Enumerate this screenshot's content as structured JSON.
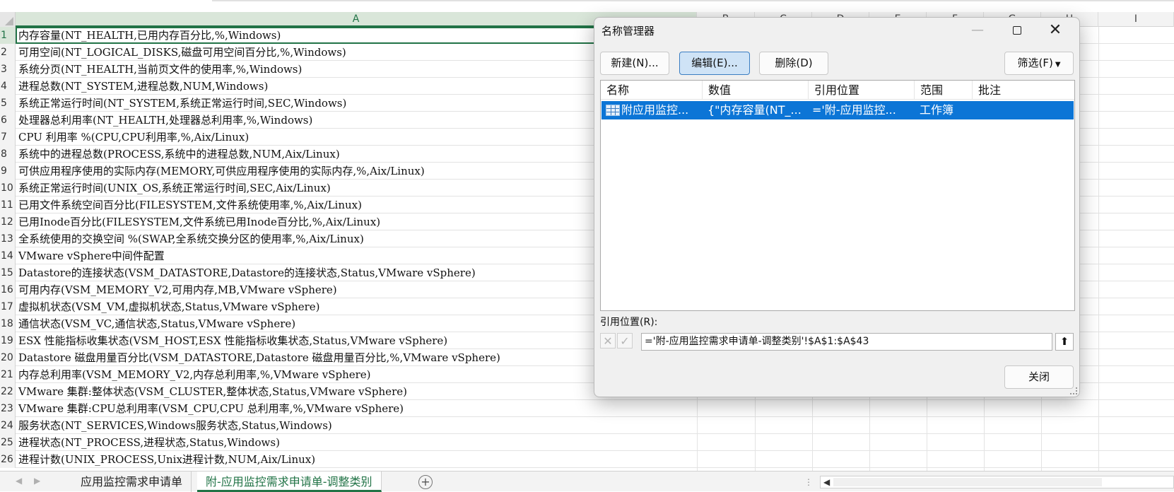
{
  "spreadsheet": {
    "columns": {
      "a": "A",
      "b": "B",
      "c": "C",
      "d": "D",
      "e": "E",
      "f": "F",
      "g": "G",
      "h": "H",
      "i": "I"
    },
    "rows": [
      {
        "n": "1",
        "text": "内存容量(NT_HEALTH,已用内存百分比,%,Windows)"
      },
      {
        "n": "2",
        "text": "可用空间(NT_LOGICAL_DISKS,磁盘可用空间百分比,%,Windows)"
      },
      {
        "n": "3",
        "text": "系统分页(NT_HEALTH,当前页文件的使用率,%,Windows)"
      },
      {
        "n": "4",
        "text": "进程总数(NT_SYSTEM,进程总数,NUM,Windows)"
      },
      {
        "n": "5",
        "text": "系统正常运行时间(NT_SYSTEM,系统正常运行时间,SEC,Windows)"
      },
      {
        "n": "6",
        "text": "处理器总利用率(NT_HEALTH,处理器总利用率,%,Windows)"
      },
      {
        "n": "7",
        "text": "CPU 利用率 %(CPU,CPU利用率,%,Aix/Linux)"
      },
      {
        "n": "8",
        "text": "系统中的进程总数(PROCESS,系统中的进程总数,NUM,Aix/Linux)"
      },
      {
        "n": "9",
        "text": "可供应用程序使用的实际内存(MEMORY,可供应用程序使用的实际内存,%,Aix/Linux)"
      },
      {
        "n": "10",
        "text": "系统正常运行时间(UNIX_OS,系统正常运行时间,SEC,Aix/Linux)"
      },
      {
        "n": "11",
        "text": "已用文件系统空间百分比(FILESYSTEM,文件系统使用率,%,Aix/Linux)"
      },
      {
        "n": "12",
        "text": "已用Inode百分比(FILESYSTEM,文件系统已用Inode百分比,%,Aix/Linux)"
      },
      {
        "n": "13",
        "text": "全系统使用的交换空间 %(SWAP,全系统交换分区的使用率,%,Aix/Linux)"
      },
      {
        "n": "14",
        "text": "VMware vSphere中间件配置"
      },
      {
        "n": "15",
        "text": "Datastore的连接状态(VSM_DATASTORE,Datastore的连接状态,Status,VMware vSphere)"
      },
      {
        "n": "16",
        "text": "可用内存(VSM_MEMORY_V2,可用内存,MB,VMware vSphere)"
      },
      {
        "n": "17",
        "text": "虚拟机状态(VSM_VM,虚拟机状态,Status,VMware vSphere)"
      },
      {
        "n": "18",
        "text": "通信状态(VSM_VC,通信状态,Status,VMware vSphere)"
      },
      {
        "n": "19",
        "text": "ESX 性能指标收集状态(VSM_HOST,ESX 性能指标收集状态,Status,VMware vSphere)"
      },
      {
        "n": "20",
        "text": "Datastore 磁盘用量百分比(VSM_DATASTORE,Datastore 磁盘用量百分比,%,VMware vSphere)"
      },
      {
        "n": "21",
        "text": "内存总利用率(VSM_MEMORY_V2,内存总利用率,%,VMware vSphere)"
      },
      {
        "n": "22",
        "text": "VMware 集群:整体状态(VSM_CLUSTER,整体状态,Status,VMware vSphere)"
      },
      {
        "n": "23",
        "text": "VMware 集群:CPU总利用率(VSM_CPU,CPU 总利用率,%,VMware vSphere)"
      },
      {
        "n": "24",
        "text": "服务状态(NT_SERVICES,Windows服务状态,Status,Windows)"
      },
      {
        "n": "25",
        "text": "进程状态(NT_PROCESS,进程状态,Status,Windows)"
      },
      {
        "n": "26",
        "text": "进程计数(UNIX_PROCESS,Unix进程计数,NUM,Aix/Linux)"
      }
    ]
  },
  "sheet_tabs": {
    "tab1": "应用监控需求申请单",
    "tab2": "附-应用监控需求申请单-调整类别",
    "add": "+"
  },
  "dialog": {
    "title": "名称管理器",
    "buttons": {
      "new": "新建(N)...",
      "edit": "编辑(E)...",
      "delete": "删除(D)",
      "filter": "筛选(F)",
      "close": "关闭"
    },
    "columns": {
      "name": "名称",
      "value": "数值",
      "refers_to": "引用位置",
      "scope": "范围",
      "comment": "批注"
    },
    "selected_row": {
      "name": "附应用监控...",
      "value": "{\"内存容量(NT_...",
      "refers_to": "='附-应用监控...",
      "scope": "工作簿",
      "comment": ""
    },
    "refers_label": "引用位置(R):",
    "refers_value": "='附-应用监控需求申请单-调整类别'!$A$1:$A$43"
  }
}
